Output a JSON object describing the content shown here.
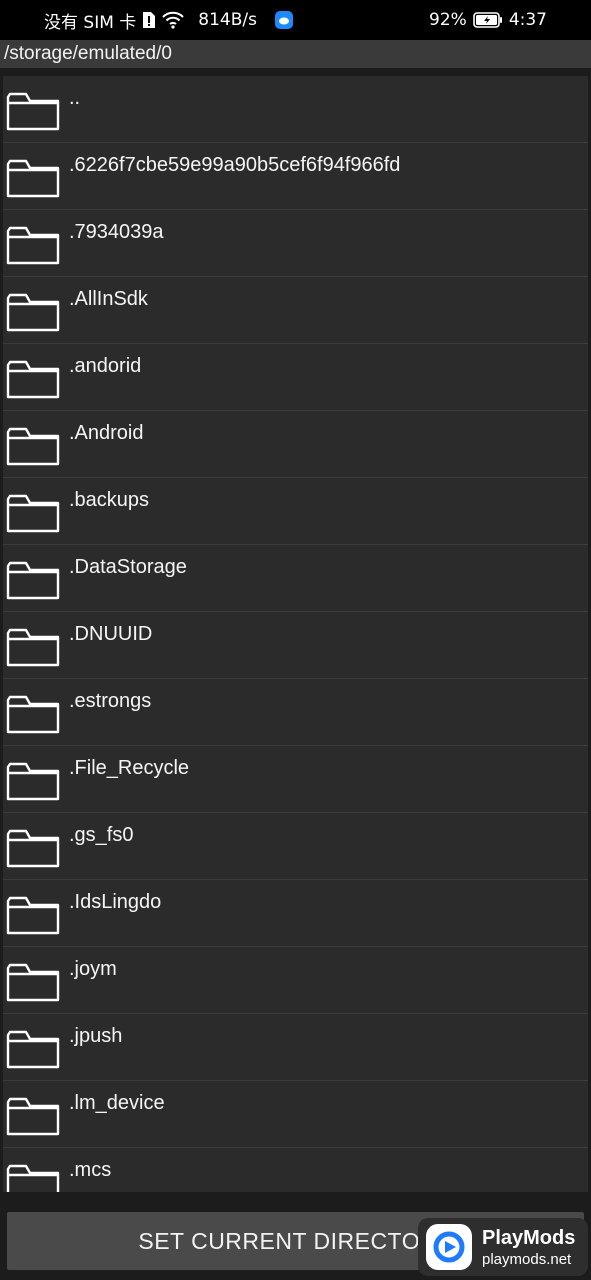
{
  "status_bar": {
    "carrier": "没有 SIM 卡",
    "network_speed": "814B/s",
    "battery_percent": "92%",
    "time": "4:37"
  },
  "path": "/storage/emulated/0",
  "entries": [
    {
      "name": ".."
    },
    {
      "name": ".6226f7cbe59e99a90b5cef6f94f966fd"
    },
    {
      "name": ".7934039a"
    },
    {
      "name": ".AllInSdk"
    },
    {
      "name": ".andorid"
    },
    {
      "name": ".Android"
    },
    {
      "name": ".backups"
    },
    {
      "name": ".DataStorage"
    },
    {
      "name": ".DNUUID"
    },
    {
      "name": ".estrongs"
    },
    {
      "name": ".File_Recycle"
    },
    {
      "name": ".gs_fs0"
    },
    {
      "name": ".IdsLingdo"
    },
    {
      "name": ".joym"
    },
    {
      "name": ".jpush"
    },
    {
      "name": ".lm_device"
    },
    {
      "name": ".mcs"
    }
  ],
  "set_button_label": "SET CURRENT DIRECTORY",
  "watermark": {
    "title": "PlayMods",
    "url": "playmods.net"
  }
}
